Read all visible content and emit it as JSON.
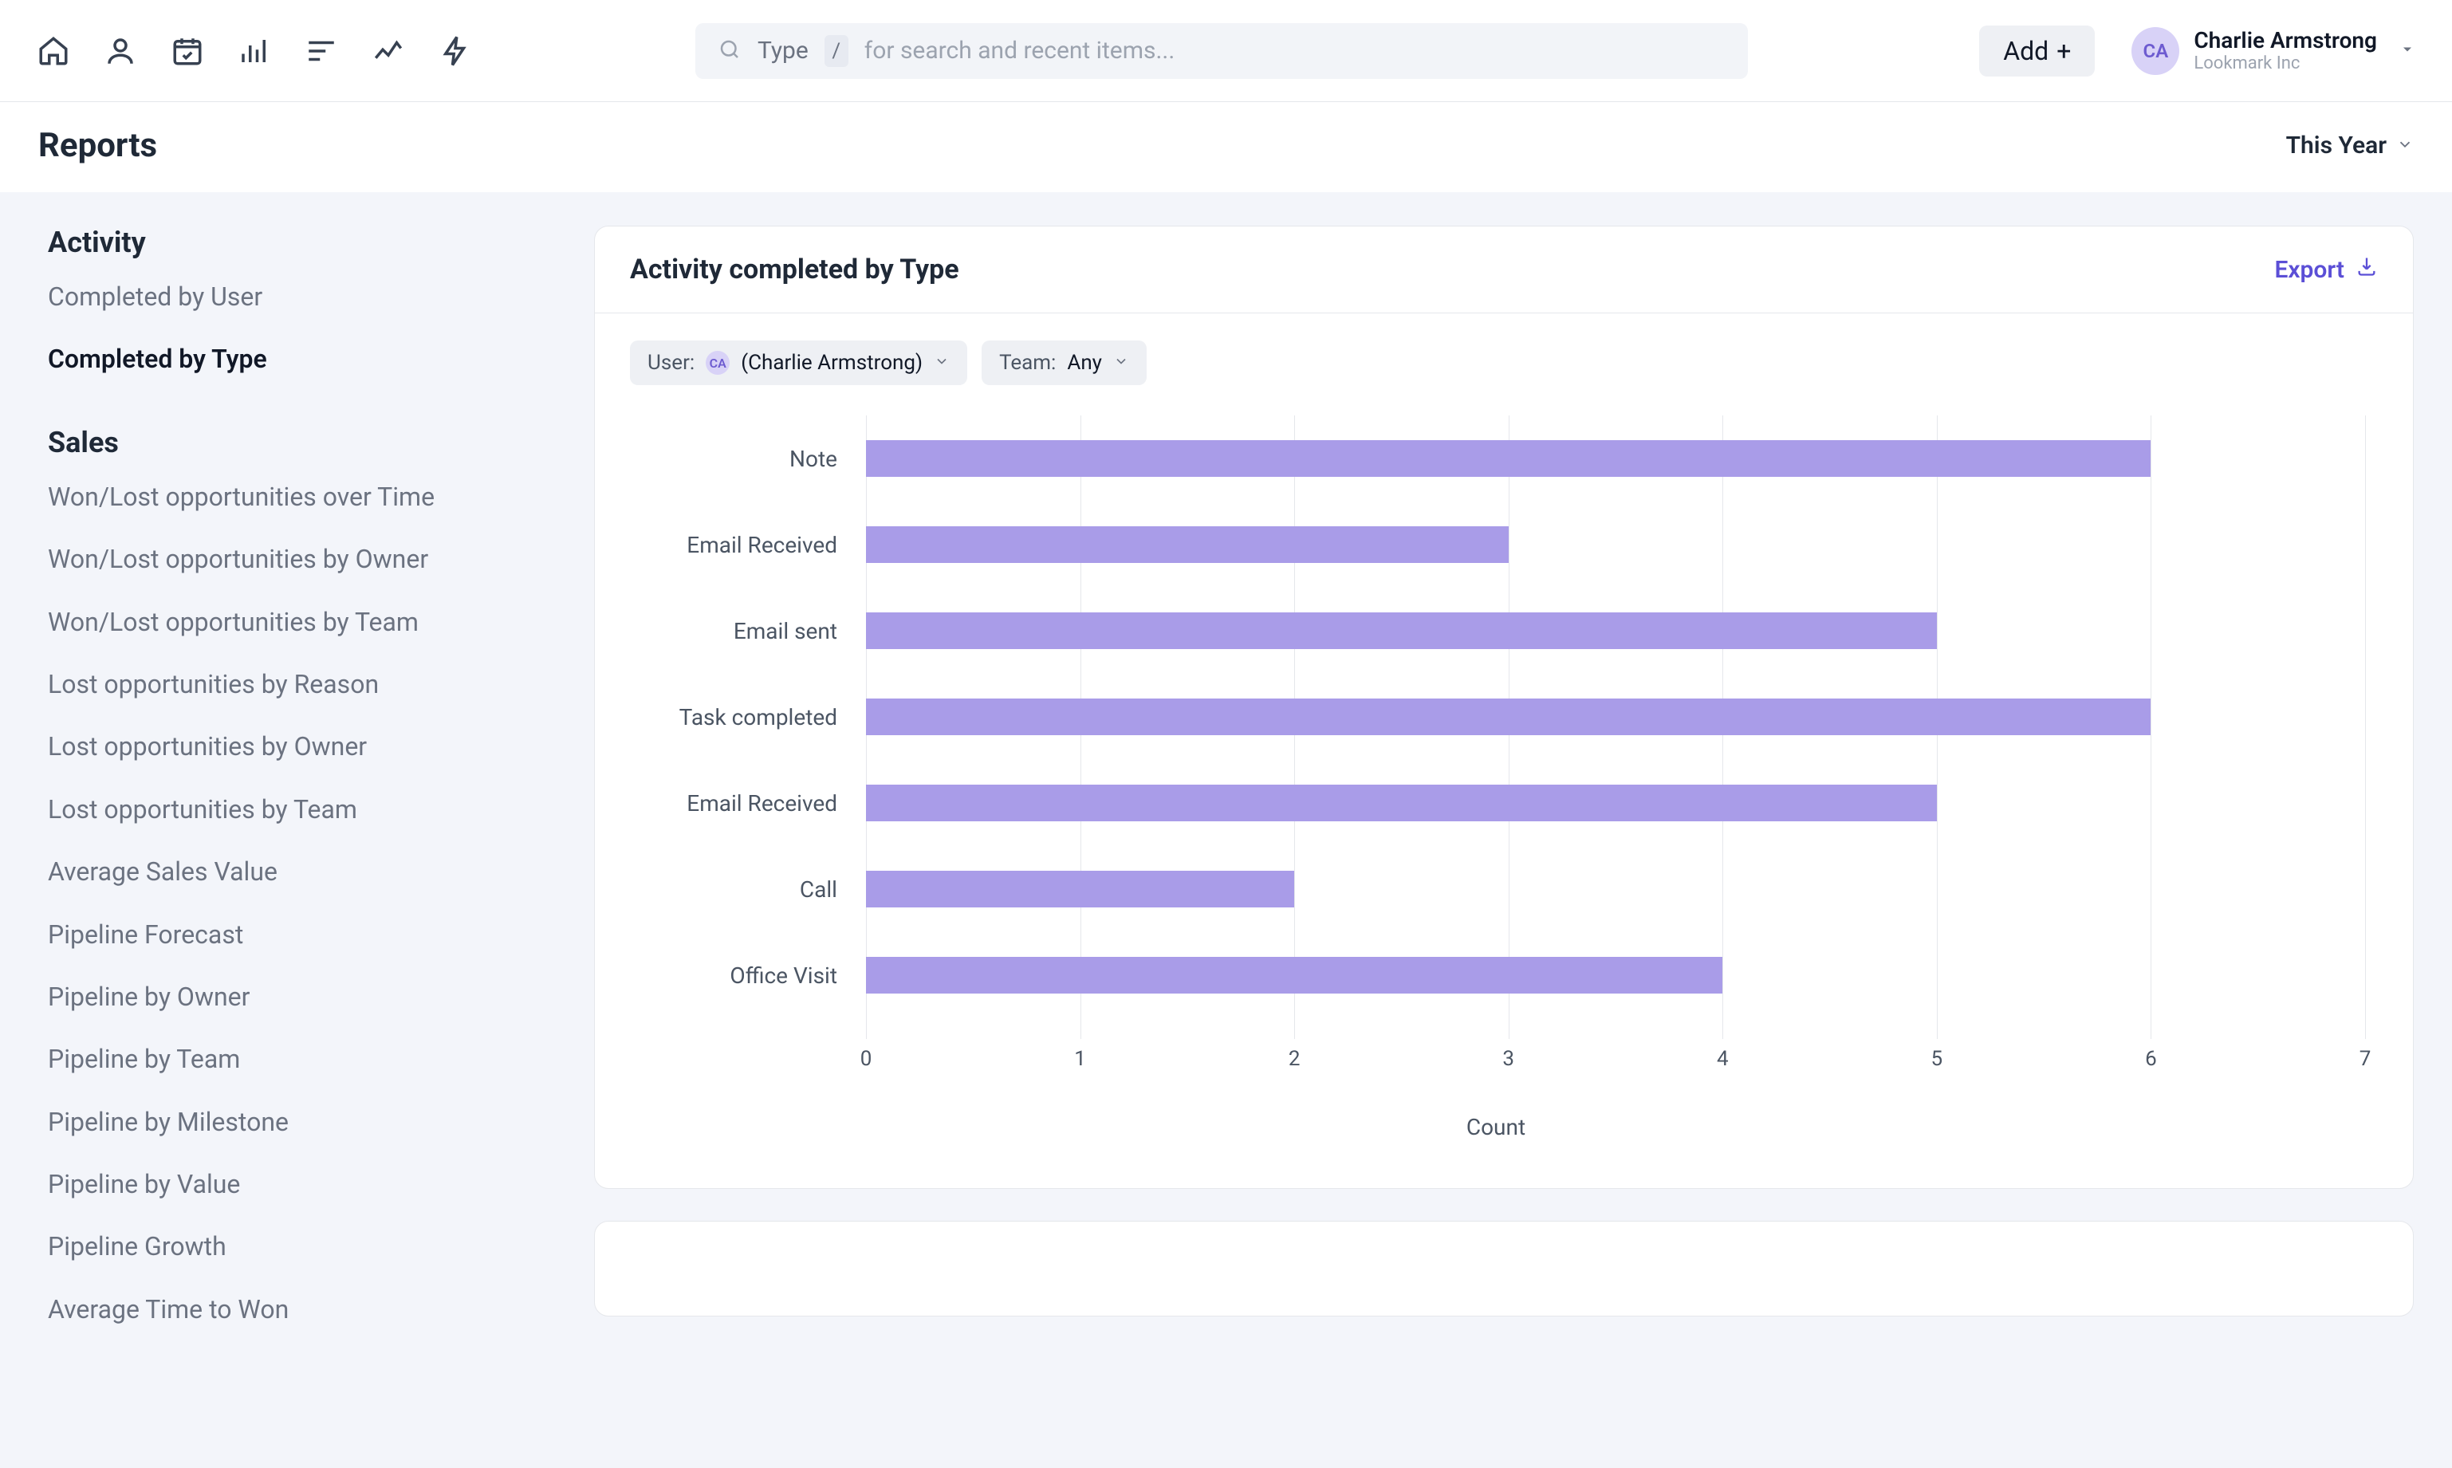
{
  "header": {
    "search_label": "Type",
    "search_hotkey": "/",
    "search_placeholder": "for search and recent items...",
    "add_label": "Add",
    "user_initials": "CA",
    "user_name": "Charlie Armstrong",
    "company": "Lookmark Inc"
  },
  "page": {
    "title": "Reports",
    "range": "This Year"
  },
  "sidebar": {
    "groups": [
      {
        "title": "Activity",
        "items": [
          {
            "label": "Completed by User",
            "active": false
          },
          {
            "label": "Completed by Type",
            "active": true
          }
        ]
      },
      {
        "title": "Sales",
        "items": [
          {
            "label": "Won/Lost opportunities over Time"
          },
          {
            "label": "Won/Lost opportunities by Owner"
          },
          {
            "label": "Won/Lost opportunities by Team"
          },
          {
            "label": "Lost opportunities by Reason"
          },
          {
            "label": "Lost opportunities by Owner"
          },
          {
            "label": "Lost opportunities by Team"
          },
          {
            "label": "Average Sales Value"
          },
          {
            "label": "Pipeline Forecast"
          },
          {
            "label": "Pipeline by Owner"
          },
          {
            "label": "Pipeline by Team"
          },
          {
            "label": "Pipeline by Milestone"
          },
          {
            "label": "Pipeline by Value"
          },
          {
            "label": "Pipeline Growth"
          },
          {
            "label": "Average Time to Won"
          }
        ]
      }
    ]
  },
  "card": {
    "title": "Activity completed by Type",
    "export": "Export",
    "filters": {
      "user_label": "User:",
      "user_value": "(Charlie Armstrong)",
      "user_initials": "CA",
      "team_label": "Team:",
      "team_value": "Any"
    }
  },
  "chart_data": {
    "type": "bar",
    "orientation": "horizontal",
    "categories": [
      "Note",
      "Email Received",
      "Email sent",
      "Task completed",
      "Email Received",
      "Call",
      "Office Visit"
    ],
    "values": [
      6,
      3,
      5,
      6,
      5,
      2,
      4
    ],
    "xlabel": "Count",
    "ylabel": "",
    "xlim": [
      0,
      7
    ],
    "xticks": [
      0,
      1,
      2,
      3,
      4,
      5,
      6,
      7
    ],
    "bar_color": "#a99ce8"
  }
}
